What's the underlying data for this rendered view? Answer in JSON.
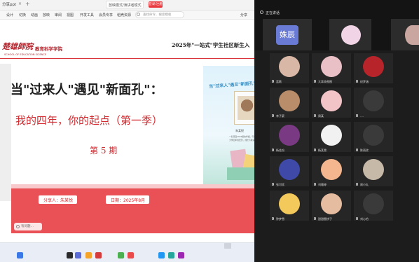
{
  "ppt": {
    "tab_title": "分享ppt",
    "tab_close": "×",
    "tab_new": "+",
    "slideshow_link": "放映模式/演讲者模式",
    "login_button": "登录/注册",
    "menu": [
      "设计",
      "切换",
      "动画",
      "放映",
      "审阅",
      "视图",
      "开发工具",
      "会员专享",
      "稻壳资源"
    ],
    "search_placeholder": "查找命令、搜索模板",
    "share": "分享"
  },
  "slide": {
    "logo_script": "楚雄師院",
    "logo_college": "教育科学学院",
    "logo_english": "SCHOOL OF EDUCATION SCIENCE",
    "header_right": "2025年\"一站式\"学生社区新生入",
    "headline": "当\"过来人\"遇见\"新面孔\"：",
    "subtitle": "我的四年，你的起点（第一季）",
    "issue": "第 5 期",
    "poster_title": "当\"过来人\"遇见\"新面孔\"",
    "poster_name": "朱某悦",
    "poster_caption_1": "一名来自2022级的学姐，与你分享",
    "poster_caption_2": "大学四年的经历，成长与收获",
    "sharer": "分享人：朱某悦",
    "date": "日期：2025年8月",
    "ask": "有问题…"
  },
  "meeting": {
    "top_label": "正在讲话",
    "speaker_name": "姝辰",
    "tiles": [
      {
        "name": "蓝歌",
        "color": "#d9b7a6"
      },
      {
        "name": "大耳朵图图",
        "color": "#eac0c7"
      },
      {
        "name": "纪梦涵",
        "color": "#b7242a"
      },
      {
        "name": "李子豪",
        "color": "#b98d6a"
      },
      {
        "name": "周某",
        "color": "#f2c4c8"
      },
      {
        "name": "....",
        "color": "#3a3a3a"
      },
      {
        "name": "杨佳怡",
        "color": "#7a3a83"
      },
      {
        "name": "杨某雪",
        "color": "#f1f1f1"
      },
      {
        "name": "陈雨欣",
        "color": "#3a3a3a"
      },
      {
        "name": "张可欣",
        "color": "#3f4aa8"
      },
      {
        "name": "刘雅婷",
        "color": "#f3b68e"
      },
      {
        "name": "周小丸",
        "color": "#c7b9a8"
      },
      {
        "name": "钟梦雪",
        "color": "#f4c95c"
      },
      {
        "name": "甜甜圈饼子",
        "color": "#e6bca0"
      },
      {
        "name": "刘心怡",
        "color": "#3a3a3a"
      }
    ]
  }
}
